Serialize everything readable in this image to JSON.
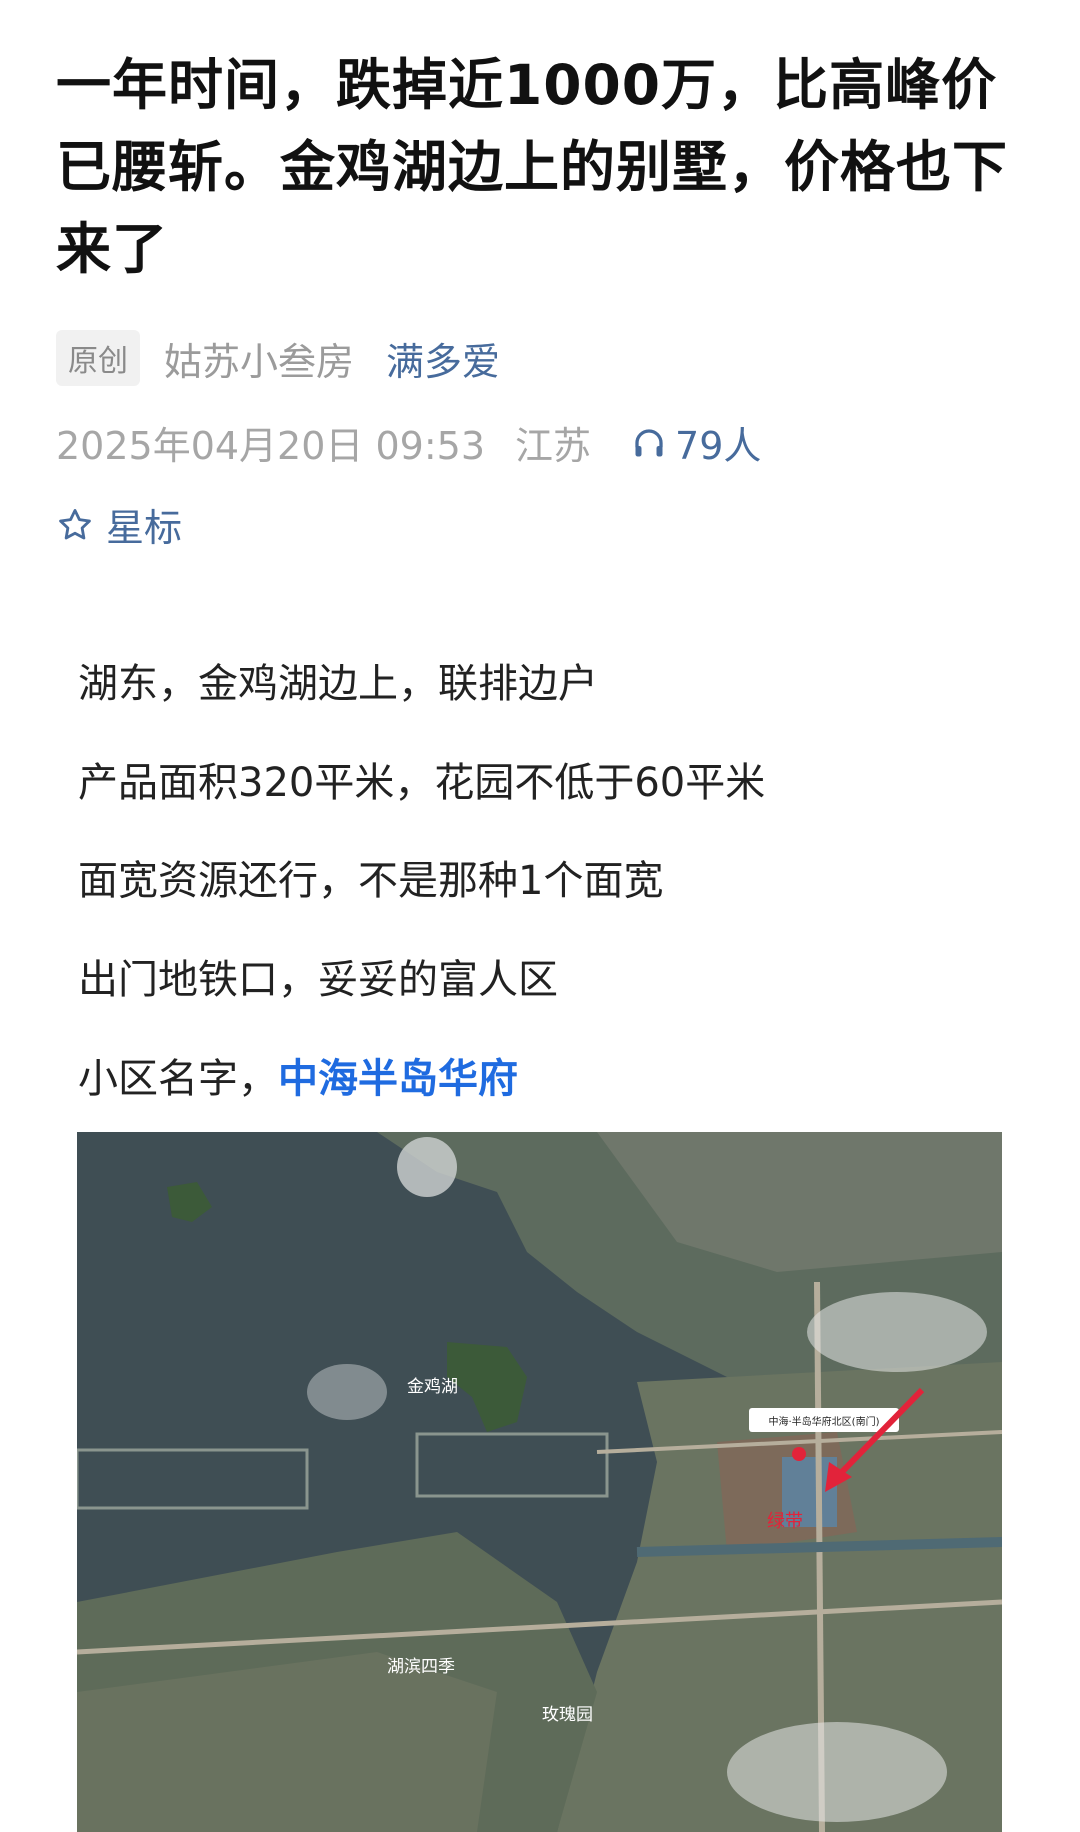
{
  "article": {
    "title": "一年时间，跌掉近1000万，比高峰价已腰斩。金鸡湖边上的别墅，价格也下来了",
    "tag": "原创",
    "author": "姑苏小叁房",
    "topic": "满多爱",
    "datetime": "2025年04月20日 09:53",
    "location": "江苏",
    "listeners": "79人",
    "star_label": "星标"
  },
  "body": {
    "lines": [
      "湖东，金鸡湖边上，联排边户",
      "产品面积320平米，花园不低于60平米",
      "面宽资源还行，不是那种1个面宽",
      "出门地铁口，妥妥的富人区"
    ],
    "community_prefix": "小区名字，",
    "community_link": "中海半岛华府"
  },
  "map": {
    "labels": {
      "lake": "金鸡湖",
      "poi": "中海·半岛华府北区(南门)",
      "greenbelt": "绿带",
      "area1": "湖滨四季",
      "area2": "玫瑰园"
    },
    "colors": {
      "arrow": "#e2233a",
      "marker": "#e2233a",
      "water": "#3f4e54"
    }
  }
}
